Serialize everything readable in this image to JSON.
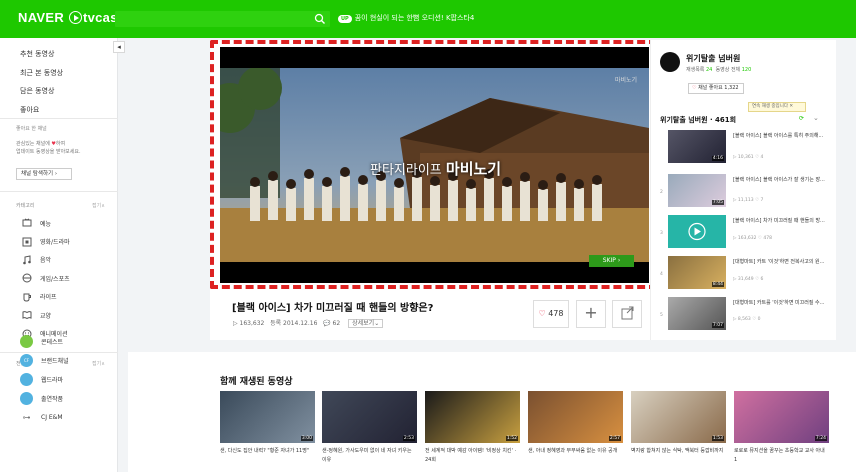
{
  "header": {
    "logo_text": "NAVER",
    "logo_suffix": "tvcast",
    "promo_pill": "UP",
    "promo_text": "꿈이 현실이 되는 한뼘 오디션! K팝스타4",
    "colors": {
      "brand": "#1ec800"
    }
  },
  "sidebar": {
    "nav": [
      "추천 동영상",
      "최근 본 동영상",
      "담은 동영상",
      "좋아요"
    ],
    "fav_title": "좋아요 한 채널",
    "fav_desc_1": "관심있는 채널에",
    "fav_desc_2": "하여",
    "fav_desc_3": "업데이트 동영상을 받아보세요.",
    "find_button": "채널 탐색하기 ›",
    "category_title": "카테고리",
    "category_more": "접기∧",
    "categories": [
      {
        "label": "예능",
        "icon": "tv-icon"
      },
      {
        "label": "영화/드라마",
        "icon": "film-icon"
      },
      {
        "label": "음악",
        "icon": "music-icon"
      },
      {
        "label": "게임/스포츠",
        "icon": "gamepad-icon"
      },
      {
        "label": "라이프",
        "icon": "cup-icon"
      },
      {
        "label": "교양",
        "icon": "book-icon"
      },
      {
        "label": "애니메이션",
        "icon": "smiley-icon"
      }
    ],
    "channel_title": "전용관",
    "channel_more": "접기∧",
    "channels": [
      {
        "label": "콘테스트",
        "abbr": "",
        "color": "#7ac943"
      },
      {
        "label": "브랜드채널",
        "abbr": "CF",
        "color": "#52b2e0"
      },
      {
        "label": "웹드라마",
        "abbr": "",
        "color": "#52b2e0"
      },
      {
        "label": "출연작품",
        "abbr": "",
        "color": "#52b2e0"
      },
      {
        "label": "CJ E&M",
        "abbr": "",
        "color": "#777777"
      }
    ]
  },
  "player": {
    "overlay_title_1": "판타지라이프",
    "overlay_title_2": "마비노기",
    "watermark": "마비노기",
    "skip_label": "SKIP ›"
  },
  "video": {
    "title": "[블랙 아이스] 차가 미끄러질 때 핸들의 방향은?",
    "views": "▷ 163,632",
    "date_label": "등록",
    "date": "2014.12.16",
    "comments": "62",
    "more_label": "상세보기⌄",
    "likes": "478"
  },
  "channel": {
    "name": "위기탈출 넘버원",
    "stats_label_1": "재생목록",
    "playlists": "24",
    "stats_label_2": "동영상 전체",
    "videos": "120",
    "like_label": "채널 좋아요",
    "like_count": "1,322",
    "tooltip": "연속 재생 중입니다  ✕",
    "playlist_title": "위기탈출 넘버원 · 461회"
  },
  "playlist": [
    {
      "num": "",
      "title": "[블랙 아이스] 블랙 아이스를 특히 주의해...",
      "stat": "▷ 10,361  ♡ 4",
      "duration": "4:16"
    },
    {
      "num": "2",
      "title": "[블랙 아이스] 블랙 아이스가 잘 생기는 장...",
      "stat": "▷ 11,113  ♡ 7",
      "duration": "7:05"
    },
    {
      "num": "3",
      "title": "[블랙 아이스] 차가 미끄러질 때 핸들의 방...",
      "stat": "▷ 163,632  ♡ 478",
      "duration": ""
    },
    {
      "num": "4",
      "title": "[대형마트] 카트 '이것'하면 전복사고의 원...",
      "stat": "▷ 31,649  ♡ 6",
      "duration": "8:44"
    },
    {
      "num": "5",
      "title": "[대형마트] 카트를 '이것'하면 미끄러질 수...",
      "stat": "▷ 8,563  ♡ 0",
      "duration": "7:07"
    }
  ],
  "related": {
    "title": "함께 재생된 동영상",
    "items": [
      {
        "title": "샌, 다신도 집안 내력? \"황준 자녀가 11명\"",
        "duration": "3:00"
      },
      {
        "title": "샌-정혜원, 가사도우미 없이 네 자녀 키우는 이유",
        "duration": "2:53"
      },
      {
        "title": "전 세계적 대박 예감 아이템! '비정상 치킨' · 24회",
        "duration": "1:52"
      },
      {
        "title": "샌, 아내 정혜영과 부부싸움 없는 이유 공개",
        "duration": "2:57"
      },
      {
        "title": "벽지랑 합쳐지 않는 식탁, 맥북터 등깝비까지",
        "duration": "1:53"
      },
      {
        "title": "로로로 뮤지션을 꿈꾸는 초등학교 교사 아내 1",
        "duration": "7:24"
      }
    ]
  }
}
